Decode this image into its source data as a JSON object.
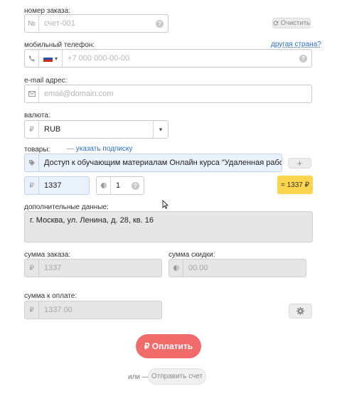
{
  "order_number": {
    "label": "номер заказа:",
    "placeholder": "счет-001",
    "prefix_symbol": "№",
    "help": "?",
    "clear_button": "Очистить"
  },
  "phone": {
    "label": "мобильный телефон:",
    "other_country_link": "другая страна?",
    "placeholder": "+7 000 000-00-00",
    "flag_icon": "russia-flag-icon",
    "dropdown_caret": "▾"
  },
  "email": {
    "label": "e-mail адрес:",
    "placeholder": "email@domain.com"
  },
  "currency": {
    "label": "валюта:",
    "prefix_symbol": "₽",
    "value": "RUB",
    "caret": "▾"
  },
  "goods": {
    "label": "товары:",
    "caption_dash": "—",
    "caption_link": "указать подписку",
    "item_name": "Доступ к обучающим материалам Онлайн курса \"Удаленная работа\", паке",
    "add_button": "+",
    "price_prefix": "₽",
    "price": "1337",
    "quantity": "1",
    "quantity_help": "?",
    "total": "= 1337 ₽"
  },
  "extra": {
    "label": "дополнительные данные:",
    "value": "г. Москва, ул. Ленина, д. 28, кв. 16"
  },
  "order_sum": {
    "label": "сумма заказа:",
    "prefix_symbol": "₽",
    "value": "1337"
  },
  "discount_sum": {
    "label": "сумма скидки:",
    "prefix_symbol": "₽",
    "value": "00.00"
  },
  "payment_sum": {
    "label": "сумма к оплате:",
    "prefix_symbol": "₽",
    "value": "1337.00"
  },
  "actions": {
    "pay_button": "₽ Оплатить",
    "or_text": "или —",
    "send_invoice_button": "Отправить счет"
  },
  "colors": {
    "pay_button": "#f26b6b",
    "total_badge": "#fcd54e",
    "link": "#2a6fc9"
  }
}
